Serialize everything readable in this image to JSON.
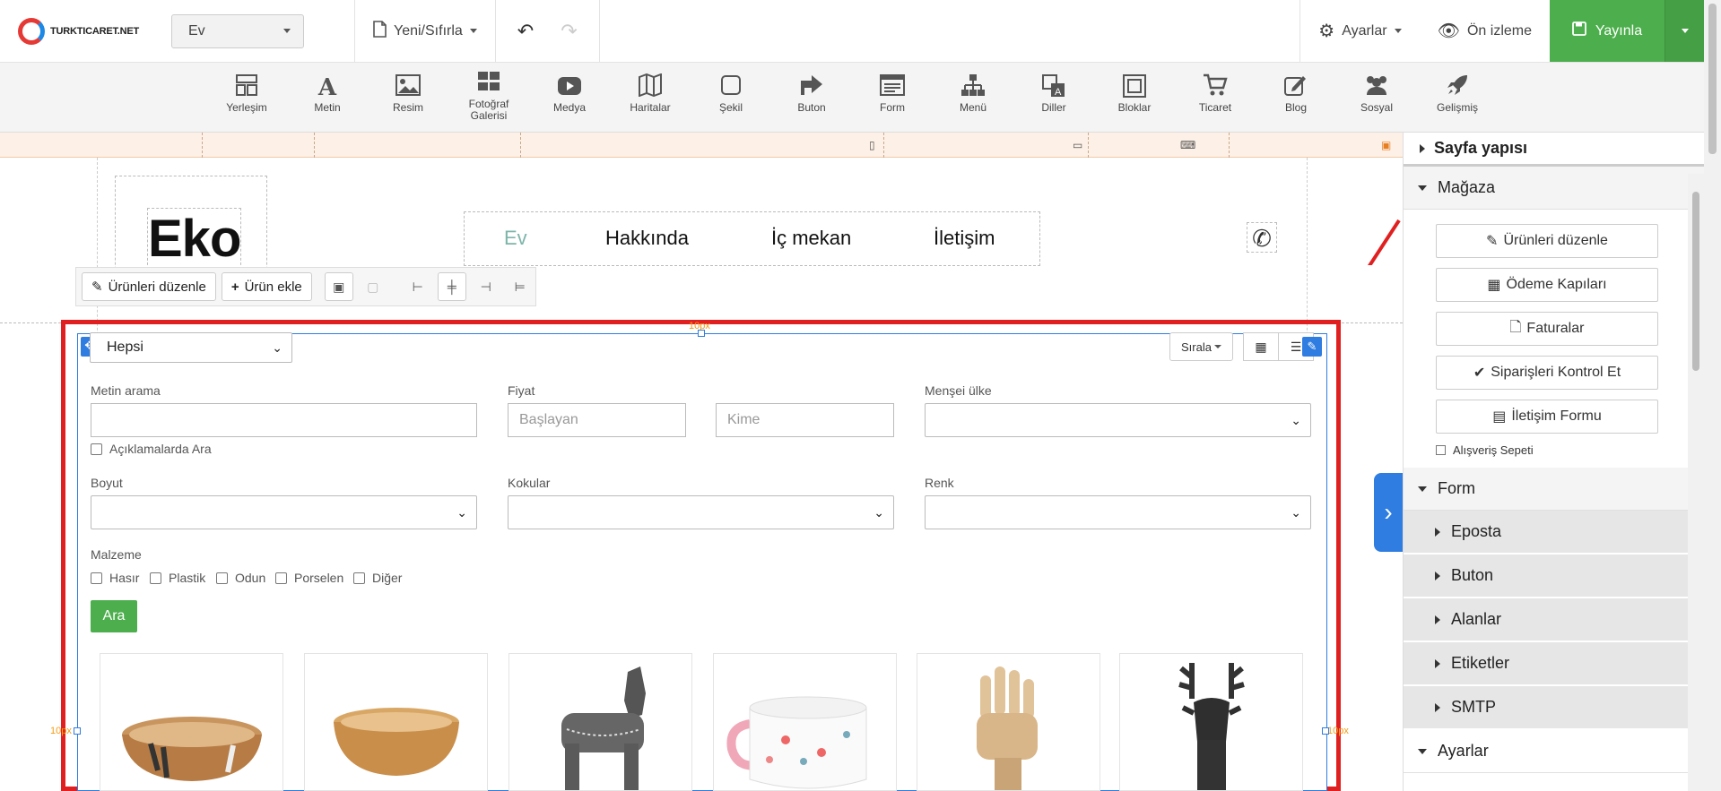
{
  "brand": {
    "logo_text": "TURKTICARET.NET"
  },
  "topbar": {
    "page_select": "Ev",
    "new_reset": "Yeni/Sıfırla",
    "settings": "Ayarlar",
    "preview": "Ön izleme",
    "publish": "Yayınla"
  },
  "toolbar": {
    "items": [
      {
        "label": "Yerleşim",
        "icon": "layout-icon"
      },
      {
        "label": "Metin",
        "icon": "text-icon"
      },
      {
        "label": "Resim",
        "icon": "image-icon"
      },
      {
        "label": "Fotoğraf Galerisi",
        "icon": "gallery-icon"
      },
      {
        "label": "Medya",
        "icon": "media-icon"
      },
      {
        "label": "Haritalar",
        "icon": "map-icon"
      },
      {
        "label": "Şekil",
        "icon": "shape-icon"
      },
      {
        "label": "Buton",
        "icon": "button-icon"
      },
      {
        "label": "Form",
        "icon": "form-icon"
      },
      {
        "label": "Menü",
        "icon": "menu-icon"
      },
      {
        "label": "Diller",
        "icon": "languages-icon"
      },
      {
        "label": "Bloklar",
        "icon": "blocks-icon"
      },
      {
        "label": "Ticaret",
        "icon": "cart-icon"
      },
      {
        "label": "Blog",
        "icon": "blog-icon"
      },
      {
        "label": "Sosyal",
        "icon": "social-icon"
      },
      {
        "label": "Gelişmiş",
        "icon": "rocket-icon"
      }
    ]
  },
  "site": {
    "title": "Eko",
    "nav": [
      "Ev",
      "Hakkında",
      "İç mekan",
      "İletişim"
    ],
    "active_nav_color": "#7db5a8"
  },
  "element_toolbar": {
    "edit_products": "Ürünleri düzenle",
    "add_product": "Ürün ekle"
  },
  "store": {
    "padding_label": "10px",
    "category_select": "Hepsi",
    "sort_label": "Sırala",
    "search_label": "Metin arama",
    "search_in_desc": "Açıklamalarda Ara",
    "price_label": "Fiyat",
    "price_from_placeholder": "Başlayan",
    "price_to_placeholder": "Kime",
    "origin_label": "Menşei ülke",
    "size_label": "Boyut",
    "scents_label": "Kokular",
    "color_label": "Renk",
    "material_label": "Malzeme",
    "materials": [
      "Hasır",
      "Plastik",
      "Odun",
      "Porselen",
      "Diğer"
    ],
    "search_button": "Ara"
  },
  "panel": {
    "page_structure": "Sayfa yapısı",
    "store_section": "Mağaza",
    "store_buttons": [
      "Ürünleri düzenle",
      "Ödeme Kapıları",
      "Faturalar",
      "Siparişleri Kontrol Et",
      "İletişim Formu"
    ],
    "cart_checkbox": "Alışveriş Sepeti",
    "form_section": "Form",
    "form_items": [
      "Eposta",
      "Buton",
      "Alanlar",
      "Etiketler",
      "SMTP"
    ],
    "settings_section": "Ayarlar"
  },
  "colors": {
    "accent": "#2f7de1",
    "publish": "#4cae4c",
    "highlight": "#e02020"
  }
}
